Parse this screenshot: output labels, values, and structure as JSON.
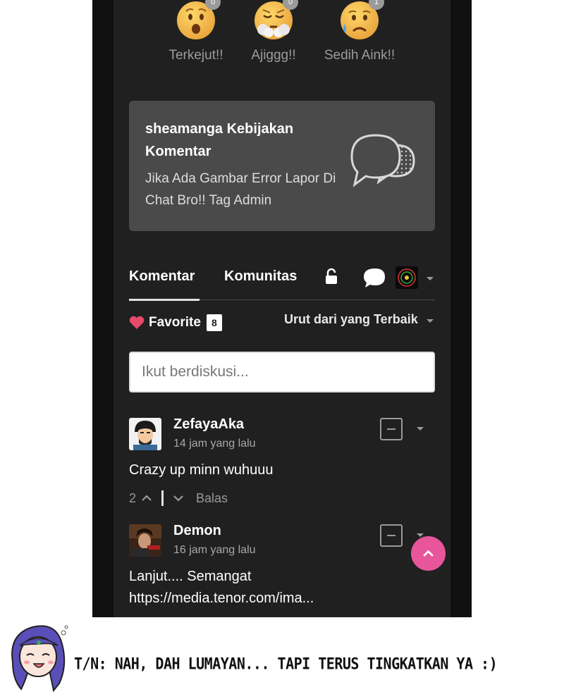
{
  "reactions": [
    {
      "icon": "surprised-emoji-icon",
      "label": "Terkejut!!",
      "count": "0"
    },
    {
      "icon": "steaming-emoji-icon",
      "label": "Ajiggg!!",
      "count": "0"
    },
    {
      "icon": "sad-sweat-emoji-icon",
      "label": "Sedih Aink!!",
      "count": "1"
    }
  ],
  "policy": {
    "title": "sheamanga Kebijakan Komentar",
    "body": "Jika Ada Gambar Error Lapor Di Chat Bro!! Tag Admin",
    "icon": "speech-bubbles-icon"
  },
  "tabs": [
    {
      "label": "Komentar",
      "active": true
    },
    {
      "label": "Komunitas",
      "active": false
    }
  ],
  "toolbar_icons": [
    "lock-icon",
    "chat-bubble-icon",
    "user-avatar",
    "chevron-down-icon"
  ],
  "favorite": {
    "label": "Favorite",
    "count": "8",
    "icon": "heart-icon"
  },
  "sort": {
    "label": "Urut dari yang Terbaik"
  },
  "compose": {
    "placeholder": "Ikut berdiskusi..."
  },
  "comments": [
    {
      "author": "ZefayaAka",
      "time": "14 jam yang lalu",
      "text": "Crazy up minn wuhuuu",
      "upvotes": "2",
      "reply_label": "Balas"
    },
    {
      "author": "Demon",
      "time": "16 jam yang lalu",
      "text_lines": [
        "Lanjut.... Semangat",
        "https://media.tenor.com/ima..."
      ]
    }
  ],
  "translator_note": "T/N: NAH, DAH LUMAYAN... TAPI TERUS TINGKATKAN YA :)",
  "colors": {
    "panel": "#202020",
    "frame": "#111111",
    "card": "#4a4a4a",
    "accent_pink": "#e8559a",
    "heart": "#e84a6a"
  }
}
